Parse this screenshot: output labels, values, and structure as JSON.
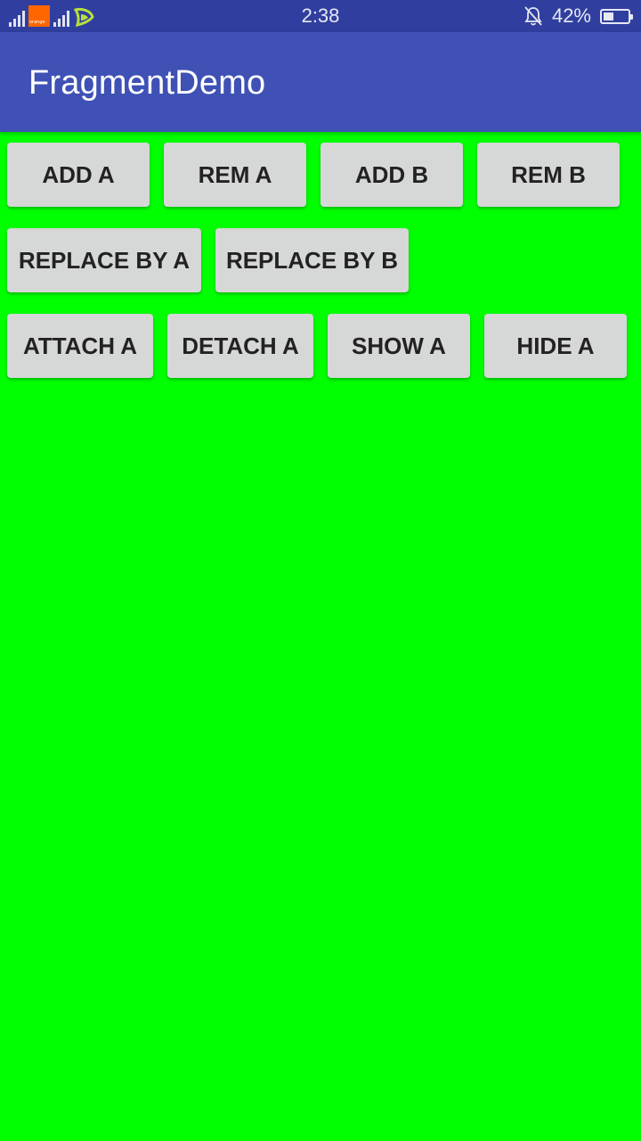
{
  "status_bar": {
    "time": "2:38",
    "battery_percent": "42%",
    "battery_level": 0.42,
    "carrier_badge": "orange",
    "icons": [
      "signal-icon",
      "orange-carrier-icon",
      "signal-icon",
      "etisalat-carrier-icon",
      "bell-off-icon",
      "battery-icon"
    ]
  },
  "app_bar": {
    "title": "FragmentDemo",
    "color": "#3f51b5"
  },
  "content": {
    "background": "#00ff00",
    "buttons": {
      "add_a": "ADD A",
      "rem_a": "REM A",
      "add_b": "ADD B",
      "rem_b": "REM B",
      "replace_by_a": "REPLACE BY A",
      "replace_by_b": "REPLACE BY B",
      "attach_a": "ATTACH A",
      "detach_a": "DETACH A",
      "show_a": "SHOW A",
      "hide_a": "HIDE A"
    }
  }
}
